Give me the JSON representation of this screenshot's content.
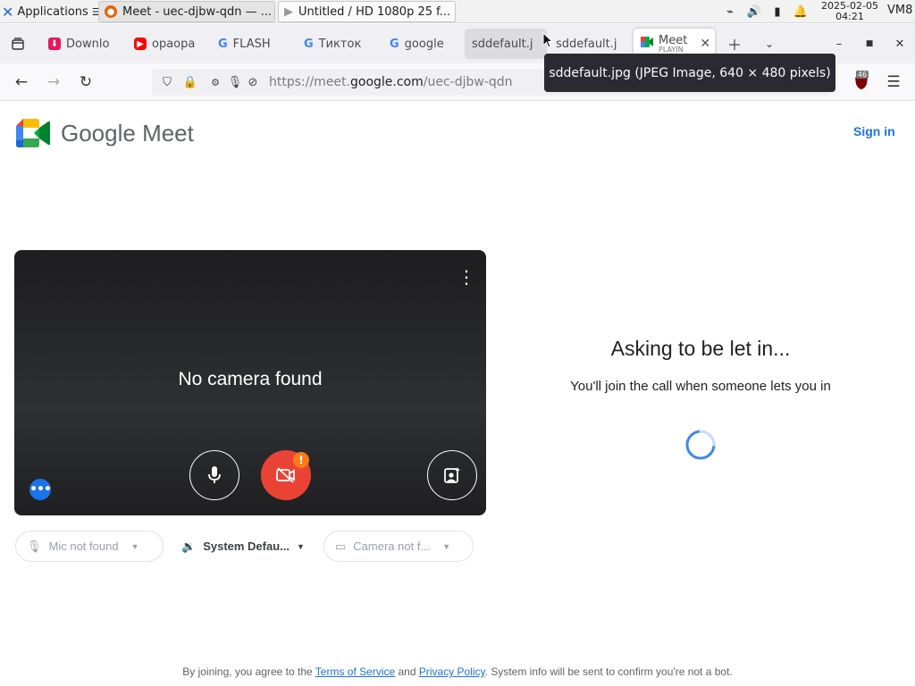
{
  "taskbar": {
    "applications_label": "Applications",
    "windows": [
      {
        "title": "Meet - uec-djbw-qdn — ..."
      },
      {
        "title": "Untitled / HD 1080p 25 f..."
      }
    ],
    "clock_date": "2025-02-05",
    "clock_time": "04:21",
    "vm_label": "VM8"
  },
  "browser": {
    "tabs": [
      {
        "label": "Downlo",
        "favicon": "download-icon",
        "color": "#e8175d"
      },
      {
        "label": "opaopa",
        "favicon": "youtube-icon",
        "color": "#ff0000"
      },
      {
        "label": "FLASH",
        "favicon": "google-icon",
        "color": "#4285f4"
      },
      {
        "label": "Тикток",
        "favicon": "google-icon",
        "color": "#4285f4"
      },
      {
        "label": "google",
        "favicon": "google-icon",
        "color": "#4285f4"
      },
      {
        "label": "sddefault.j",
        "favicon": "",
        "color": ""
      },
      {
        "label": "sddefault.j",
        "favicon": "",
        "color": ""
      },
      {
        "label": "Meet",
        "sublabel": "PLAYIN",
        "favicon": "meet-icon",
        "color": "#00832d",
        "active": true
      }
    ],
    "url_prefix": "https://meet.",
    "url_domain": "google.com",
    "url_path": "/uec-djbw-qdn",
    "extension_badge": "46",
    "tooltip": "sddefault.jpg (JPEG Image, 640 × 480 pixels)"
  },
  "meet": {
    "logo_text": "Google Meet",
    "sign_in": "Sign in",
    "preview_status": "No camera found",
    "camera_warning_badge": "!",
    "effects_label": "•••",
    "devices": {
      "mic": "Mic not found",
      "speaker": "System Defau...",
      "camera": "Camera not f..."
    },
    "asking_title": "Asking to be let in...",
    "asking_subtitle": "You'll join the call when someone lets you in"
  },
  "footer": {
    "prefix": "By joining, you agree to the ",
    "terms": "Terms of Service",
    "and": " and ",
    "privacy": "Privacy Policy",
    "suffix": ". System info will be sent to confirm you're not a bot."
  }
}
